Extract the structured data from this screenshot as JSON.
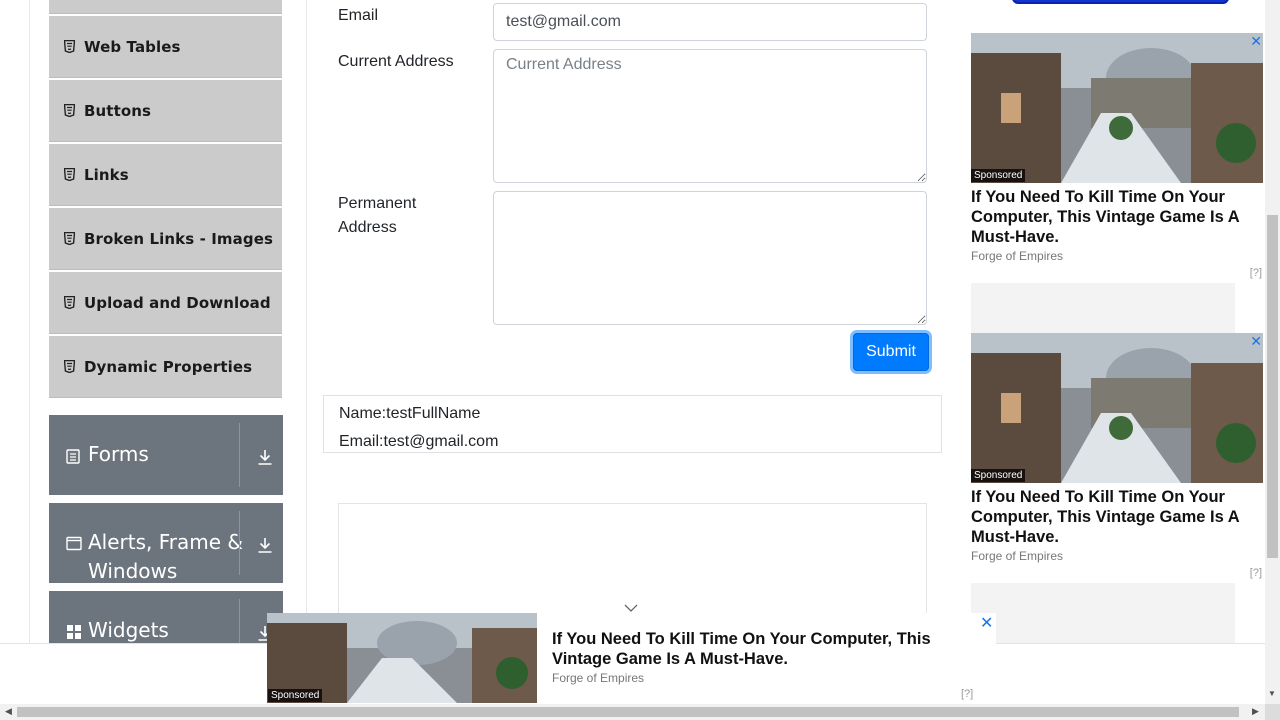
{
  "sidebar": {
    "elements_items": [
      {
        "label": "Web Tables"
      },
      {
        "label": "Buttons"
      },
      {
        "label": "Links"
      },
      {
        "label": "Broken Links - Images"
      },
      {
        "label": "Upload and Download"
      },
      {
        "label": "Dynamic Properties"
      }
    ],
    "groups": [
      {
        "label": "Forms",
        "icon": "clipboard-icon"
      },
      {
        "label": "Alerts, Frame &",
        "label2": "Windows",
        "icon": "window-icon"
      },
      {
        "label": "Widgets",
        "icon": "widgets-grid-icon"
      }
    ]
  },
  "form": {
    "email_label": "Email",
    "email_value": "test@gmail.com",
    "current_address_label": "Current Address",
    "current_address_placeholder": "Current Address",
    "permanent_address_label_1": "Permanent",
    "permanent_address_label_2": "Address",
    "submit_label": "Submit"
  },
  "output": {
    "name": "Name:testFullName",
    "email": "Email:test@gmail.com"
  },
  "ads": {
    "sponsored": "Sponsored",
    "title": "If You Need To Kill Time On Your Computer, This Vintage Game Is A Must-Have.",
    "source": "Forge of Empires",
    "info": "[?]",
    "close": "✕"
  },
  "colors": {
    "accent": "#007bff",
    "sidebar_item": "#cbcbcb",
    "group_bg": "#6c757d"
  }
}
